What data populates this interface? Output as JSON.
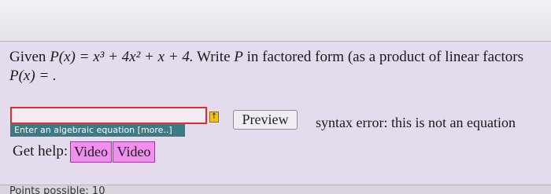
{
  "problem": {
    "given_word": "Given",
    "function_expr": "P(x) = x³ + 4x² + x + 4.",
    "instruction": "Write",
    "variable": "P",
    "instruction_tail": "in factored form (as a product of linear factors",
    "answer_prefix": "P(x) = ."
  },
  "answer": {
    "value": "",
    "help_icon": "↑",
    "hint": "Enter an algebraic equation [more..]"
  },
  "preview_label": "Preview",
  "syntax_message": "syntax error: this is not an equation",
  "help": {
    "label": "Get help:",
    "buttons": [
      "Video",
      "Video"
    ]
  },
  "points_text": "Points possible: 10",
  "colors": {
    "panel_bg": "#e4dcec",
    "answer_border_error": "#e22a2a",
    "hint_bg": "#3e7a86",
    "video_button": "#f08ff0",
    "help_icon": "#f0c21a"
  }
}
